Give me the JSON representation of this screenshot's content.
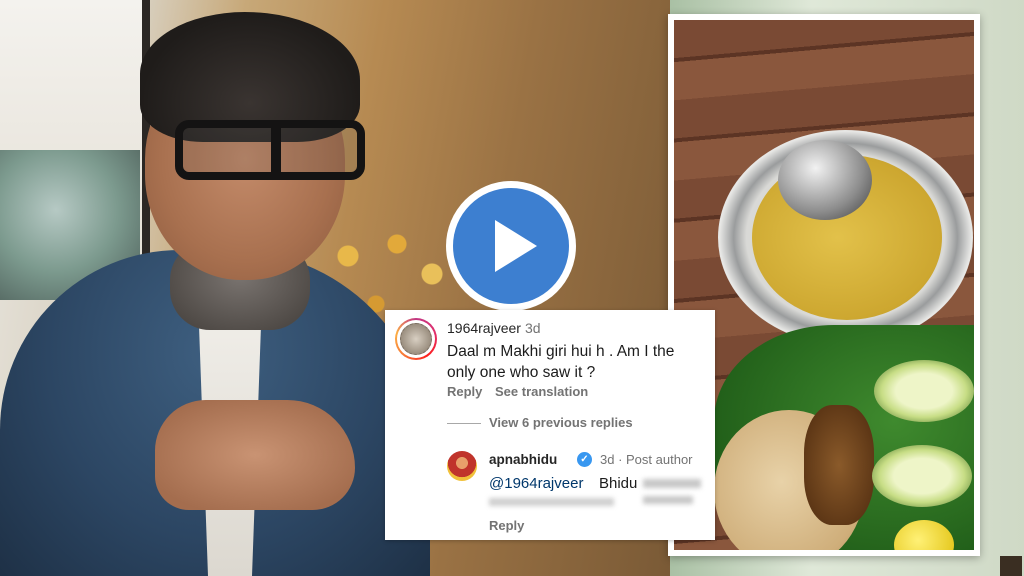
{
  "comment": {
    "username": "1964rajveer",
    "time": "3d",
    "text": "Daal m Makhi giri hui h . Am I the only one who saw it ?",
    "reply_label": "Reply",
    "translate_label": "See translation",
    "view_replies": "View 6 previous replies"
  },
  "reply": {
    "username": "apnabhidu",
    "verified": true,
    "time_meta": "3d · Post author",
    "mention": "@1964rajveer",
    "text": "Bhidu",
    "reply_label": "Reply"
  },
  "colors": {
    "play_button_fill": "#3d7fd0",
    "verified_badge": "#3897f0",
    "mention_link": "#00376b",
    "meta_text": "#737373"
  },
  "icons": {
    "play": "play-icon",
    "verified": "verified-badge-icon"
  }
}
